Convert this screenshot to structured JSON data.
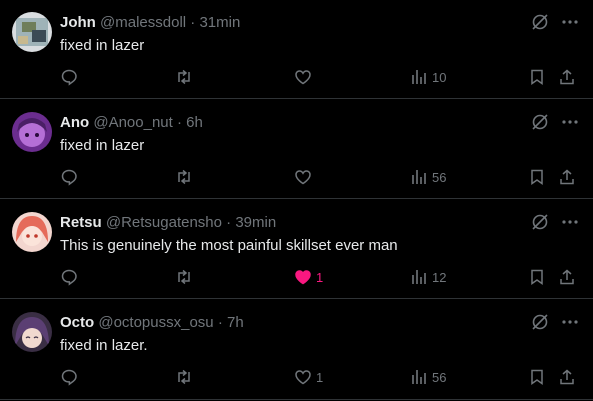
{
  "tweets": [
    {
      "name": "John",
      "handle": "@malessdoll",
      "time": "31min",
      "text": "fixed in lazer",
      "likes": "",
      "views": "10",
      "liked": false,
      "avatar_color": "#8aa0a8"
    },
    {
      "name": "Ano",
      "handle": "@Anoo_nut",
      "time": "6h",
      "text": "fixed in lazer",
      "likes": "",
      "views": "56",
      "liked": false,
      "avatar_color": "#8a3fb0"
    },
    {
      "name": "Retsu",
      "handle": "@Retsugatensho",
      "time": "39min",
      "text": "This is genuinely the most painful skillset ever man",
      "likes": "1",
      "views": "12",
      "liked": true,
      "avatar_color": "#e8806a"
    },
    {
      "name": "Octo",
      "handle": "@octopussx_osu",
      "time": "7h",
      "text": "fixed in lazer.",
      "likes": "1",
      "views": "56",
      "liked": false,
      "avatar_color": "#5a4a6a"
    }
  ],
  "separator": "·",
  "colors": {
    "background": "#000000",
    "text": "#e7e9ea",
    "muted": "#71767b",
    "border": "#2f3336",
    "like_active": "#f91880"
  },
  "icons": [
    "reply-icon",
    "retweet-icon",
    "like-icon",
    "views-icon",
    "bookmark-icon",
    "share-icon",
    "grok-icon",
    "more-icon"
  ]
}
